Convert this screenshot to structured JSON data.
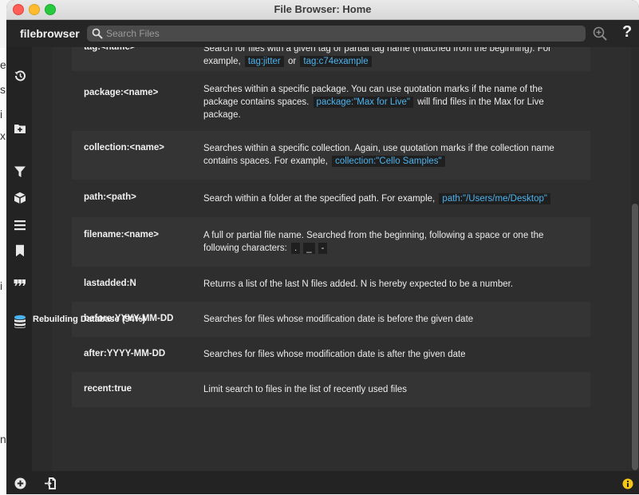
{
  "background_window": {
    "chars": [
      "e",
      "s",
      "i",
      "x",
      "i",
      "n"
    ]
  },
  "window": {
    "title": "File Browser: Home"
  },
  "toolbar": {
    "brand": "filebrowser",
    "search_placeholder": "Search Files",
    "help_label": "?"
  },
  "sidebar": {
    "icons": [
      "history-icon",
      "add-folder-icon",
      "filter-icon",
      "package-icon",
      "list-icon",
      "bookmark-icon",
      "tag-icon",
      "database-icon"
    ],
    "status": "Rebuilding Database (94%)",
    "rebuild_progress_percent": 94
  },
  "search_help": {
    "rows": [
      {
        "key": "tag:<name>",
        "parts": [
          "Search for files with a given tag or partial tag name (matched from the beginning). For example, "
        ],
        "codes": [
          "tag:jitter",
          "tag:c74example"
        ],
        "between": [
          "or"
        ]
      },
      {
        "key": "package:<name>",
        "text": "Searches within a specific package. You can use quotation marks if the name of the package contains spaces.",
        "code": "package:\"Max for Live\"",
        "after": "will find files in the Max for Live package."
      },
      {
        "key": "collection:<name>",
        "text": "Searches within a specific collection. Again, use quotation marks if the collection name contains spaces. For example,",
        "code": "collection:\"Cello Samples\""
      },
      {
        "key": "path:<path>",
        "text": "Search within a folder at the specified path. For example,",
        "code": "path:\"/Users/me/Desktop\""
      },
      {
        "key": "filename:<name>",
        "text": "A full or partial file name. Searched from the beginning, following a space or one the following characters:",
        "chars": [
          ".",
          "_",
          "-"
        ]
      },
      {
        "key": "lastadded:N",
        "text": "Returns a list of the last N files added. N is hereby expected to be a number."
      },
      {
        "key": "before:YYYY-MM-DD",
        "text": "Searches for files whose modification date is before the given date"
      },
      {
        "key": "after:YYYY-MM-DD",
        "text": "Searches for files whose modification date is after the given date"
      },
      {
        "key": "recent:true",
        "text": "Limit search to files in the list of recently used files"
      }
    ]
  },
  "bottombar": {
    "icons": [
      "add-icon",
      "import-icon",
      "info-icon"
    ]
  },
  "colors": {
    "accent": "#4db3ee",
    "info": "#f5c518"
  }
}
